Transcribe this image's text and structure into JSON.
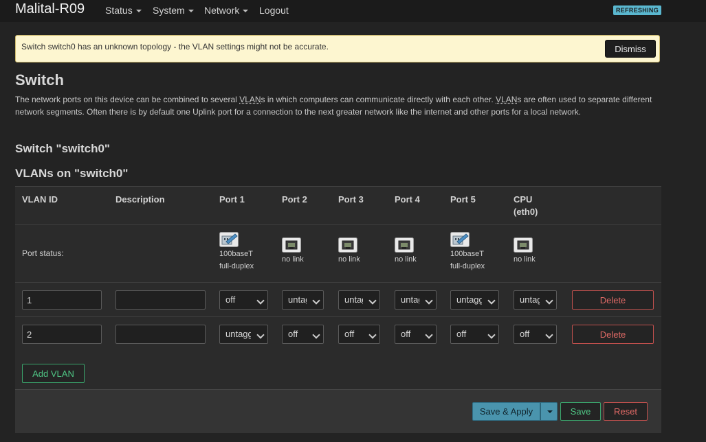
{
  "navbar": {
    "brand": "Malital-R09",
    "menu": [
      {
        "label": "Status",
        "dropdown": true
      },
      {
        "label": "System",
        "dropdown": true
      },
      {
        "label": "Network",
        "dropdown": true
      },
      {
        "label": "Logout",
        "dropdown": false
      }
    ],
    "badge": "REFRESHING"
  },
  "alert": {
    "text": "Switch switch0 has an unknown topology - the VLAN settings might not be accurate.",
    "dismiss_label": "Dismiss"
  },
  "page": {
    "title": "Switch",
    "description_parts": [
      "The network ports on this device can be combined to several ",
      "VLAN",
      "s in which computers can communicate directly with each other. ",
      "VLAN",
      "s are often used to separate different network segments. Often there is by default one Uplink port for a connection to the next greater network like the internet and other ports for a local network."
    ],
    "switch_heading": "Switch \"switch0\"",
    "vlans_heading": "VLANs on \"switch0\""
  },
  "table": {
    "headers": {
      "vlan_id": "VLAN ID",
      "description": "Description",
      "port1": "Port 1",
      "port2": "Port 2",
      "port3": "Port 3",
      "port4": "Port 4",
      "port5": "Port 5",
      "cpu": "CPU",
      "cpu_sub": "(eth0)"
    },
    "port_status_label": "Port status:",
    "port_status": [
      {
        "icon": "ethernet-connected-icon",
        "line1": "100baseT",
        "line2": "full-duplex"
      },
      {
        "icon": "ethernet-disconnected-icon",
        "line1": "no link",
        "line2": ""
      },
      {
        "icon": "ethernet-disconnected-icon",
        "line1": "no link",
        "line2": ""
      },
      {
        "icon": "ethernet-disconnected-icon",
        "line1": "no link",
        "line2": ""
      },
      {
        "icon": "ethernet-connected-icon",
        "line1": "100baseT",
        "line2": "full-duplex"
      },
      {
        "icon": "ethernet-disconnected-icon",
        "line1": "no link",
        "line2": ""
      }
    ],
    "rows": [
      {
        "vlan_id": "1",
        "description": "",
        "ports": [
          "off",
          "untagged",
          "untagged",
          "untagged",
          "untagged",
          "untagged"
        ],
        "delete_label": "Delete"
      },
      {
        "vlan_id": "2",
        "description": "",
        "ports": [
          "untagged",
          "off",
          "off",
          "off",
          "off",
          "off"
        ],
        "delete_label": "Delete"
      }
    ],
    "add_label": "Add VLAN"
  },
  "actions": {
    "save_apply_label": "Save & Apply",
    "save_label": "Save",
    "reset_label": "Reset"
  },
  "colors": {
    "badge": "#5ab7cf",
    "alert_bg": "#fdf6d0",
    "delete": "#c0504d",
    "positive": "#3aa56c",
    "apply": "#4a94ad"
  }
}
